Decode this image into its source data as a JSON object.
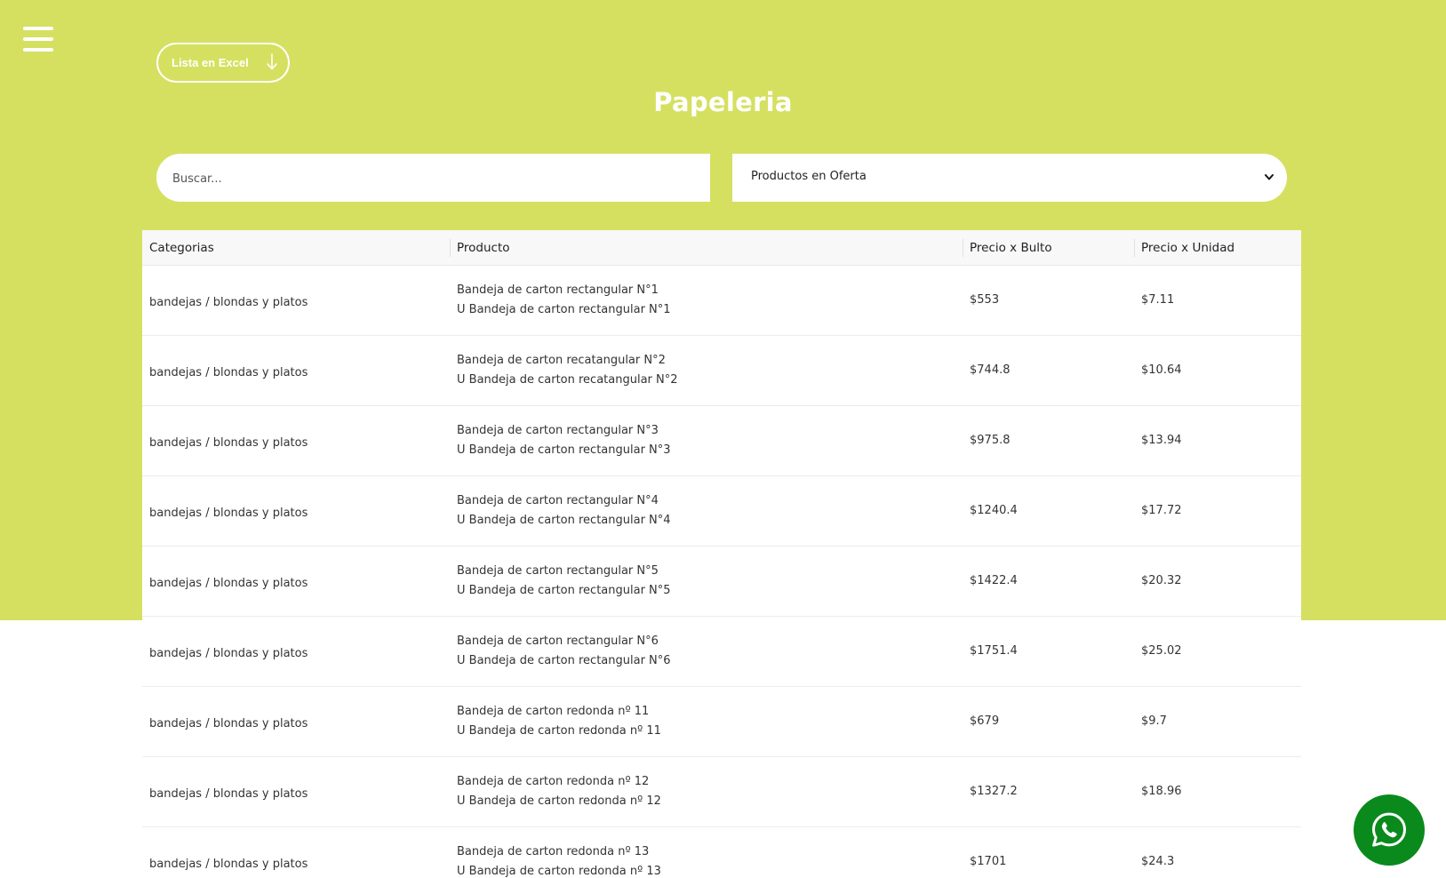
{
  "colors": {
    "hero_bg": "#d5e060",
    "white": "#ffffff",
    "whatsapp_green": "#0a8a1c"
  },
  "toolbar": {
    "excel_label": "Lista en Excel",
    "excel_icon": "arrow-down-icon"
  },
  "page": {
    "title": "Papeleria"
  },
  "search": {
    "placeholder": "Buscar..."
  },
  "filter": {
    "selected": "Productos en Oferta"
  },
  "table": {
    "headers": [
      "Categorias",
      "Producto",
      "Precio x Bulto",
      "Precio x Unidad"
    ],
    "rows": [
      {
        "category": "bandejas / blondas y platos",
        "product_line1": "Bandeja de carton rectangular N°1",
        "product_line2": "U Bandeja de carton rectangular N°1",
        "price_bulk": "$553",
        "price_unit": "$7.11"
      },
      {
        "category": "bandejas / blondas y platos",
        "product_line1": "Bandeja de carton recatangular N°2",
        "product_line2": "U Bandeja de carton recatangular N°2",
        "price_bulk": "$744.8",
        "price_unit": "$10.64"
      },
      {
        "category": "bandejas / blondas y platos",
        "product_line1": "Bandeja de carton rectangular N°3",
        "product_line2": "U Bandeja de carton rectangular N°3",
        "price_bulk": "$975.8",
        "price_unit": "$13.94"
      },
      {
        "category": "bandejas / blondas y platos",
        "product_line1": "Bandeja de carton rectangular N°4",
        "product_line2": "U Bandeja de carton rectangular N°4",
        "price_bulk": "$1240.4",
        "price_unit": "$17.72"
      },
      {
        "category": "bandejas / blondas y platos",
        "product_line1": "Bandeja de carton rectangular N°5",
        "product_line2": "U Bandeja de carton rectangular N°5",
        "price_bulk": "$1422.4",
        "price_unit": "$20.32"
      },
      {
        "category": "bandejas / blondas y platos",
        "product_line1": "Bandeja de carton rectangular N°6",
        "product_line2": "U Bandeja de carton rectangular N°6",
        "price_bulk": "$1751.4",
        "price_unit": "$25.02"
      },
      {
        "category": "bandejas / blondas y platos",
        "product_line1": "Bandeja de carton redonda nº 11",
        "product_line2": "U Bandeja de carton redonda nº 11",
        "price_bulk": "$679",
        "price_unit": "$9.7"
      },
      {
        "category": "bandejas / blondas y platos",
        "product_line1": "Bandeja de carton redonda nº 12",
        "product_line2": "U Bandeja de carton redonda nº 12",
        "price_bulk": "$1327.2",
        "price_unit": "$18.96"
      },
      {
        "category": "bandejas / blondas y platos",
        "product_line1": "Bandeja de carton redonda nº 13",
        "product_line2": "U Bandeja de carton redonda nº 13",
        "price_bulk": "$1701",
        "price_unit": "$24.3"
      }
    ]
  },
  "icons": {
    "menu": "hamburger-menu-icon",
    "select": "chevron-down-icon",
    "chat": "whatsapp-icon"
  }
}
